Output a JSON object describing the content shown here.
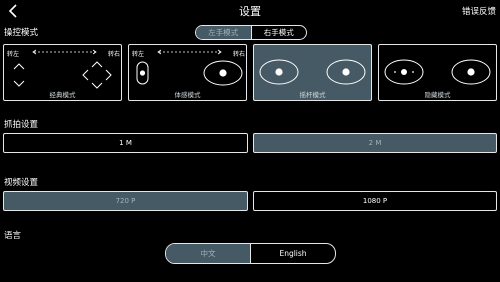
{
  "header": {
    "title": "设置",
    "feedback": "错误反馈",
    "back_icon": "chevron-left-icon"
  },
  "control": {
    "title": "操控模式",
    "hand_tabs": [
      {
        "label": "左手模式",
        "selected": true
      },
      {
        "label": "右手模式",
        "selected": false
      }
    ],
    "turn_left": "转左",
    "turn_right": "转右",
    "modes": [
      {
        "label": "经典模式",
        "selected": false
      },
      {
        "label": "体感模式",
        "selected": false
      },
      {
        "label": "摇杆模式",
        "selected": true
      },
      {
        "label": "隐藏模式",
        "selected": false
      }
    ]
  },
  "capture": {
    "title": "抓拍设置",
    "options": [
      {
        "label": "1 M",
        "selected": false
      },
      {
        "label": "2 M",
        "selected": true
      }
    ]
  },
  "video": {
    "title": "视频设置",
    "options": [
      {
        "label": "720 P",
        "selected": true
      },
      {
        "label": "1080 P",
        "selected": false
      }
    ]
  },
  "language": {
    "title": "语言",
    "options": [
      {
        "label": "中文",
        "selected": true
      },
      {
        "label": "English",
        "selected": false
      }
    ]
  }
}
